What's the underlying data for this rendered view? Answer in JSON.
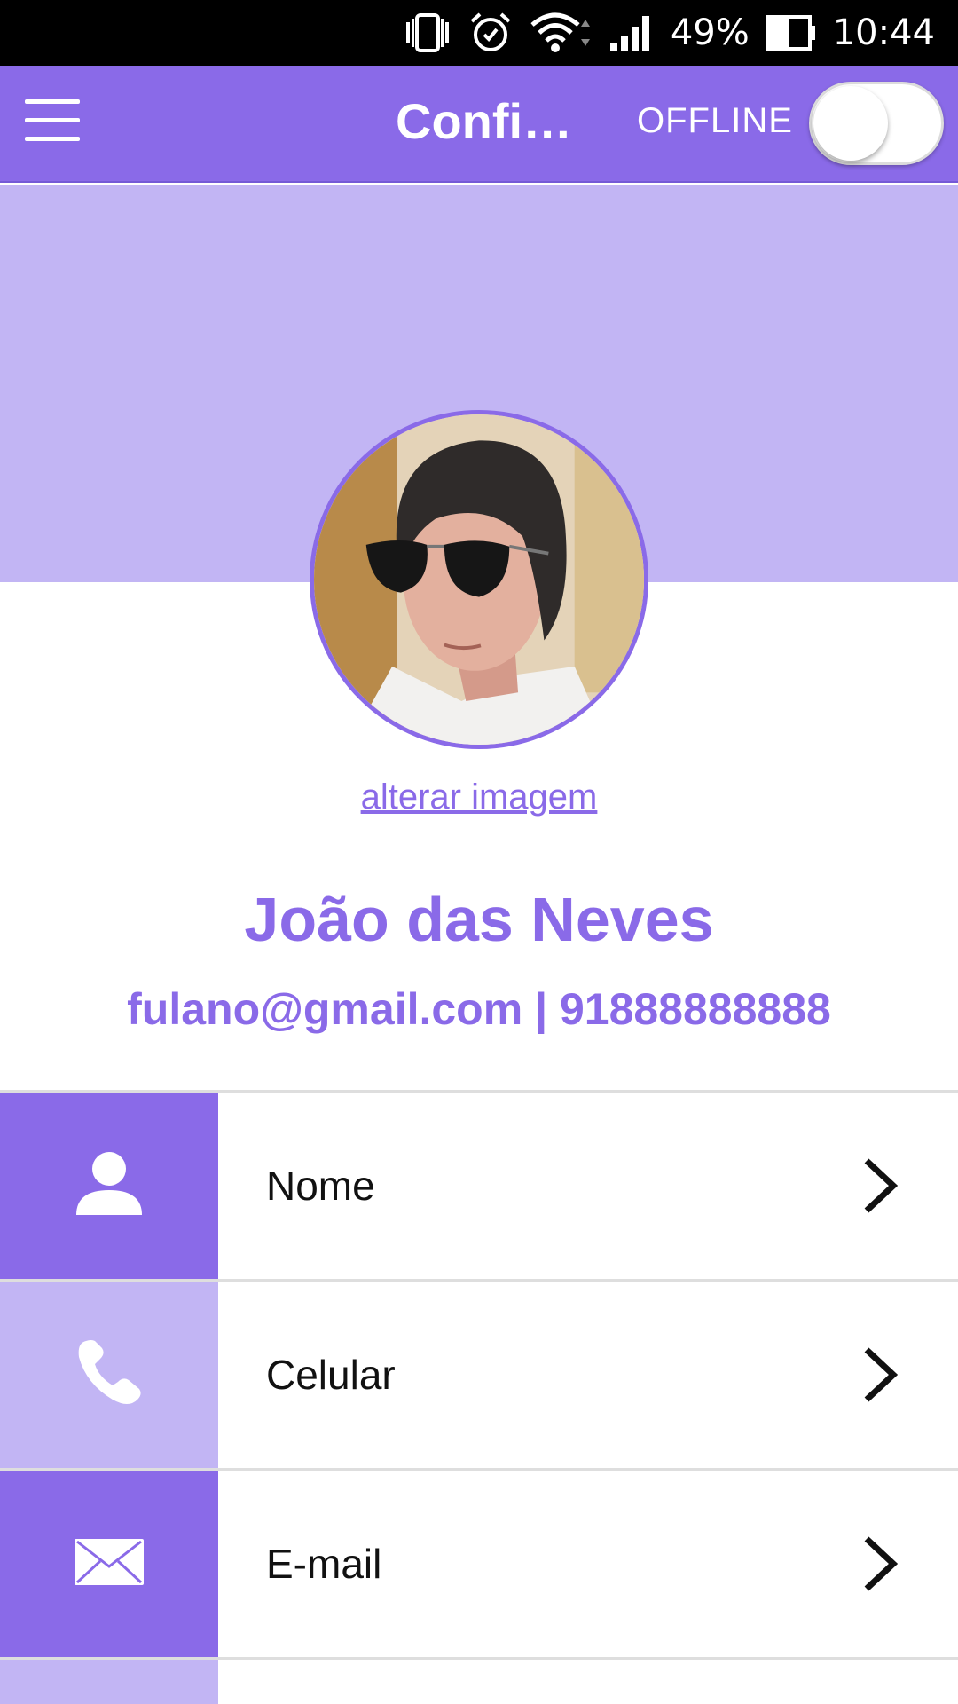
{
  "status_bar": {
    "battery_percent": "49%",
    "time": "10:44",
    "icons": [
      "vibrate-icon",
      "alarm-icon",
      "wifi-icon",
      "signal-icon",
      "battery-icon"
    ]
  },
  "app_bar": {
    "title": "Config...",
    "offline_label": "OFFLINE",
    "toggle_on": false,
    "color": "#8a6ae8"
  },
  "profile": {
    "change_image_label": "alterar imagem",
    "name": "João das Neves",
    "contact": "fulano@gmail.com | 91888888888"
  },
  "settings": {
    "items": [
      {
        "label": "Nome",
        "icon": "person-icon",
        "bg": "#8a6ae8"
      },
      {
        "label": "Celular",
        "icon": "phone-icon",
        "bg": "#c2b5f4"
      },
      {
        "label": "E-mail",
        "icon": "mail-icon",
        "bg": "#8a6ae8"
      },
      {
        "label": "",
        "icon": "",
        "bg": "#c2b5f4"
      }
    ]
  },
  "colors": {
    "primary": "#8a6ae8",
    "light": "#c2b5f4"
  }
}
